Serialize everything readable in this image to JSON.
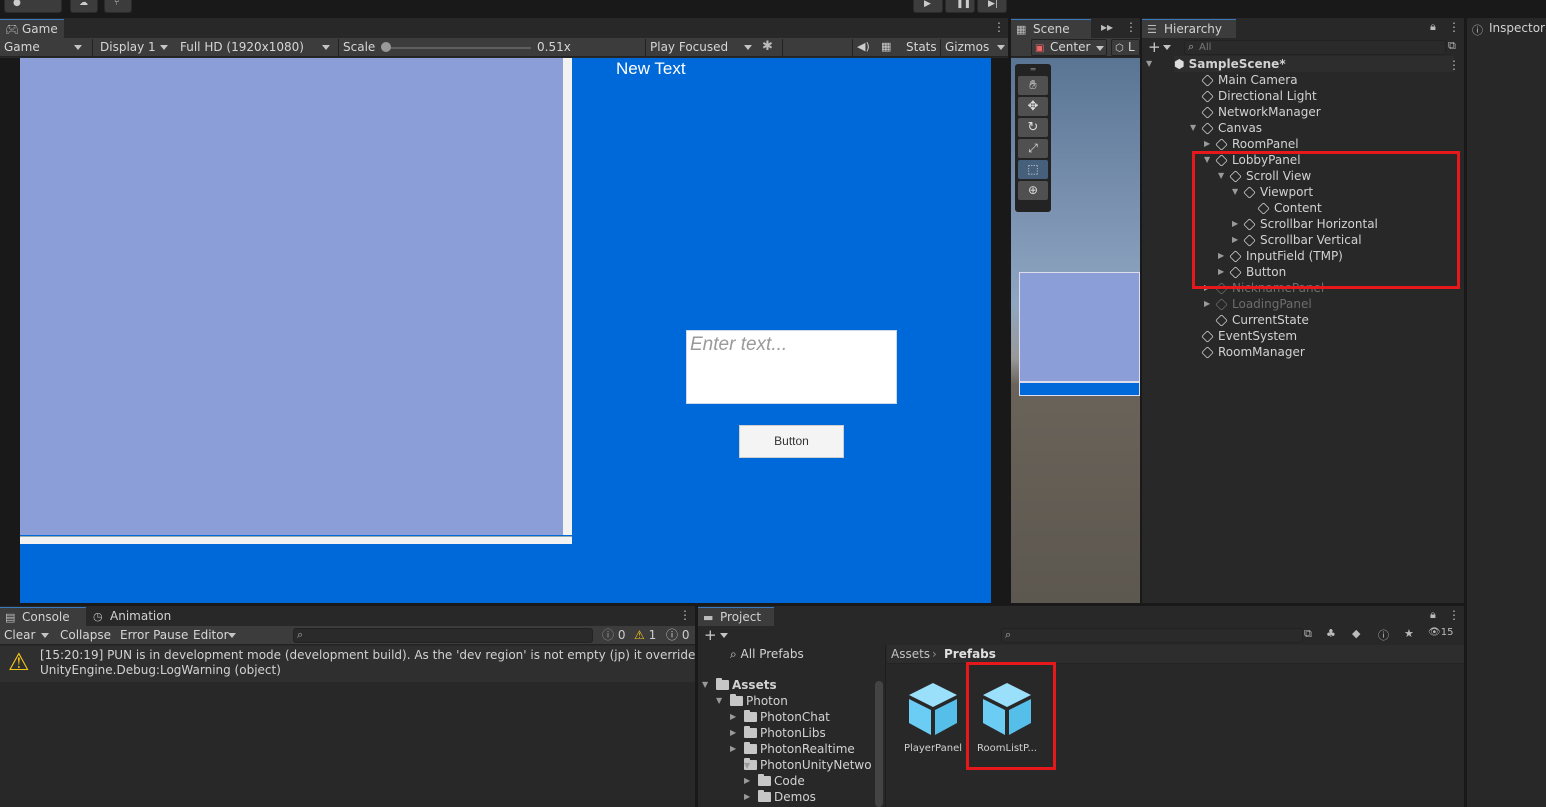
{
  "game_tab": {
    "label": "Game"
  },
  "game_toolbar": {
    "mode": "Game",
    "display": "Display 1",
    "resolution": "Full HD (1920x1080)",
    "scale_label": "Scale",
    "scale_value": "0.51x",
    "play_mode": "Play Focused",
    "stats": "Stats",
    "gizmos": "Gizmos"
  },
  "game_view": {
    "text_label": "New Text",
    "input_placeholder": "Enter text...",
    "button_label": "Button",
    "background": "#0069d9",
    "panel_color": "#8b9ed8"
  },
  "scene": {
    "tab": "Scene",
    "pivot": "Center",
    "second": "L"
  },
  "hierarchy": {
    "tab": "Hierarchy",
    "search_placeholder": "All",
    "scene_name": "SampleScene*",
    "items": [
      {
        "label": "Main Camera"
      },
      {
        "label": "Directional Light"
      },
      {
        "label": "NetworkManager"
      },
      {
        "label": "Canvas"
      },
      {
        "label": "RoomPanel"
      },
      {
        "label": "LobbyPanel"
      },
      {
        "label": "Scroll View"
      },
      {
        "label": "Viewport"
      },
      {
        "label": "Content"
      },
      {
        "label": "Scrollbar Horizontal"
      },
      {
        "label": "Scrollbar Vertical"
      },
      {
        "label": "InputField (TMP)"
      },
      {
        "label": "Button"
      },
      {
        "label": "NicknamePanel"
      },
      {
        "label": "LoadingPanel"
      },
      {
        "label": "CurrentState"
      },
      {
        "label": "EventSystem"
      },
      {
        "label": "RoomManager"
      }
    ]
  },
  "inspector": {
    "tab": "Inspector"
  },
  "console": {
    "tab": "Console",
    "animation_tab": "Animation",
    "clear": "Clear",
    "collapse": "Collapse",
    "error_pause": "Error Pause",
    "editor": "Editor",
    "info_count": "0",
    "warning_count": "1",
    "error_count": "0",
    "message_line1": "[15:20:19] PUN is in development mode (development build). As the 'dev region' is not empty (jp) it overrides the found",
    "message_line2": "UnityEngine.Debug:LogWarning (object)"
  },
  "project": {
    "tab": "Project",
    "hidden_count": "15",
    "all_prefabs": "All Prefabs",
    "tree": [
      {
        "label": "Assets"
      },
      {
        "label": "Photon"
      },
      {
        "label": "PhotonChat"
      },
      {
        "label": "PhotonLibs"
      },
      {
        "label": "PhotonRealtime"
      },
      {
        "label": "PhotonUnityNetwor"
      },
      {
        "label": "Code"
      },
      {
        "label": "Demos"
      }
    ],
    "breadcrumb_root": "Assets",
    "breadcrumb_current": "Prefabs",
    "assets": [
      {
        "label": "PlayerPanel"
      },
      {
        "label": "RoomListP..."
      }
    ]
  },
  "colors": {
    "highlight": "#e5181b",
    "prefab_cube": "#6ccdf4",
    "tab_accent": "#3a79bb"
  }
}
